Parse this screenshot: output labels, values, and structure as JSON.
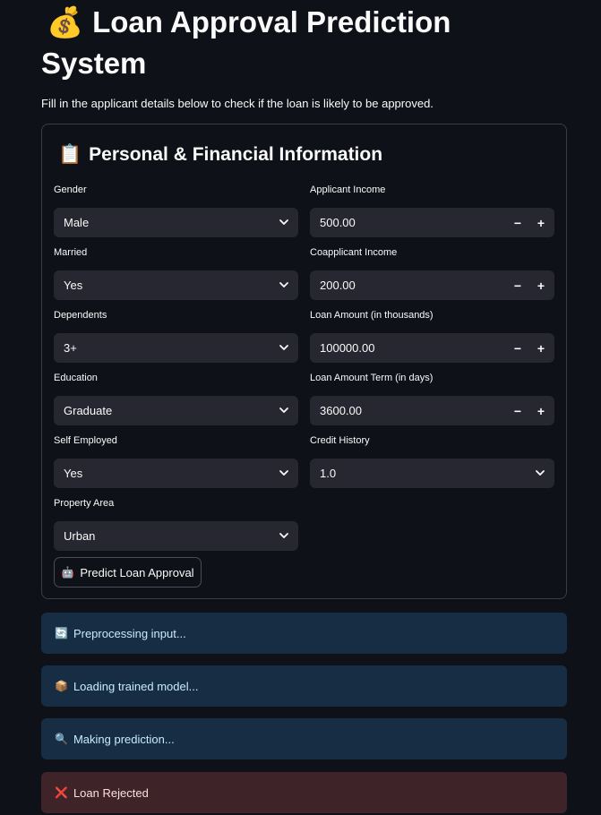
{
  "header": {
    "icon": "money-bag-icon",
    "emoji": "💰",
    "title": "Loan Approval Prediction System",
    "intro": "Fill in the applicant details below to check if the loan is likely to be approved."
  },
  "form": {
    "section_icon": "clipboard-icon",
    "section_emoji": "📋",
    "section_title": "Personal & Financial Information",
    "gender": {
      "label": "Gender",
      "value": "Male"
    },
    "married": {
      "label": "Married",
      "value": "Yes"
    },
    "dependents": {
      "label": "Dependents",
      "value": "3+"
    },
    "education": {
      "label": "Education",
      "value": "Graduate"
    },
    "self_employed": {
      "label": "Self Employed",
      "value": "Yes"
    },
    "property_area": {
      "label": "Property Area",
      "value": "Urban"
    },
    "applicant_income": {
      "label": "Applicant Income",
      "value": "500.00"
    },
    "coapplicant_income": {
      "label": "Coapplicant Income",
      "value": "200.00"
    },
    "loan_amount": {
      "label": "Loan Amount (in thousands)",
      "value": "100000.00"
    },
    "loan_term": {
      "label": "Loan Amount Term (in days)",
      "value": "3600.00"
    },
    "credit_history": {
      "label": "Credit History",
      "value": "1.0"
    },
    "stepper_minus": "−",
    "stepper_plus": "+",
    "predict_button_icon": "robot-icon",
    "predict_button_emoji": "🤖",
    "predict_button_label": "Predict Loan Approval"
  },
  "status": {
    "preprocessing": {
      "icon": "refresh-icon",
      "emoji": "🔄",
      "text": "Preprocessing input..."
    },
    "loading": {
      "icon": "package-icon",
      "emoji": "📦",
      "text": "Loading trained model..."
    },
    "predicting": {
      "icon": "magnifier-icon",
      "emoji": "🔍",
      "text": "Making prediction..."
    },
    "result": {
      "icon": "cross-mark-icon",
      "emoji": "❌",
      "text": "Loan Rejected"
    }
  },
  "colors": {
    "background": "#0e1117",
    "input_background": "#262730",
    "info_background": "#172d43",
    "info_text": "#c7ebff",
    "error_background": "#3e2428",
    "error_text": "#ffdede"
  }
}
